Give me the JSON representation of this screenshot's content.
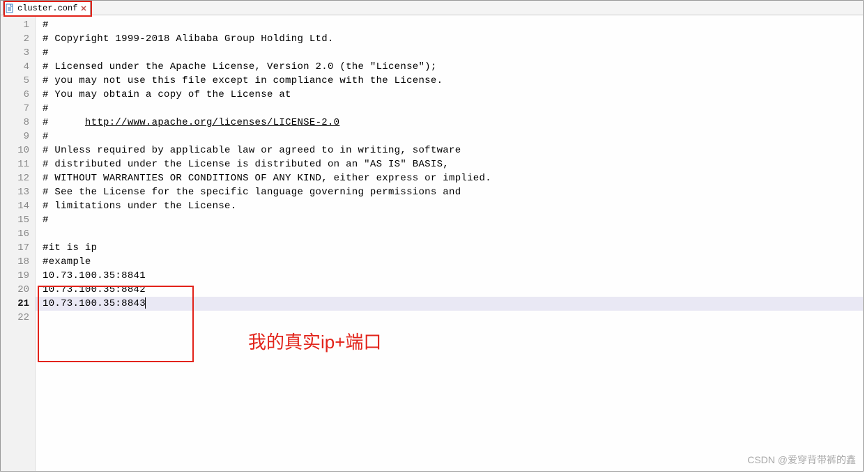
{
  "tab": {
    "filename": "cluster.conf"
  },
  "current_line": 21,
  "lines": [
    {
      "n": 1,
      "t": "#"
    },
    {
      "n": 2,
      "t": "# Copyright 1999-2018 Alibaba Group Holding Ltd."
    },
    {
      "n": 3,
      "t": "#"
    },
    {
      "n": 4,
      "t": "# Licensed under the Apache License, Version 2.0 (the \"License\");"
    },
    {
      "n": 5,
      "t": "# you may not use this file except in compliance with the License."
    },
    {
      "n": 6,
      "t": "# You may obtain a copy of the License at"
    },
    {
      "n": 7,
      "t": "#"
    },
    {
      "n": 8,
      "prefix": "#      ",
      "link": "http://www.apache.org/licenses/LICENSE-2.0"
    },
    {
      "n": 9,
      "t": "#"
    },
    {
      "n": 10,
      "t": "# Unless required by applicable law or agreed to in writing, software"
    },
    {
      "n": 11,
      "t": "# distributed under the License is distributed on an \"AS IS\" BASIS,"
    },
    {
      "n": 12,
      "t": "# WITHOUT WARRANTIES OR CONDITIONS OF ANY KIND, either express or implied."
    },
    {
      "n": 13,
      "t": "# See the License for the specific language governing permissions and"
    },
    {
      "n": 14,
      "t": "# limitations under the License."
    },
    {
      "n": 15,
      "t": "#"
    },
    {
      "n": 16,
      "t": ""
    },
    {
      "n": 17,
      "t": "#it is ip"
    },
    {
      "n": 18,
      "t": "#example"
    },
    {
      "n": 19,
      "t": "10.73.100.35:8841"
    },
    {
      "n": 20,
      "t": "10.73.100.35:8842"
    },
    {
      "n": 21,
      "t": "10.73.100.35:8843"
    },
    {
      "n": 22,
      "t": ""
    }
  ],
  "annotation": "我的真实ip+端口",
  "watermark": "CSDN @爱穿背带裤的鑫"
}
